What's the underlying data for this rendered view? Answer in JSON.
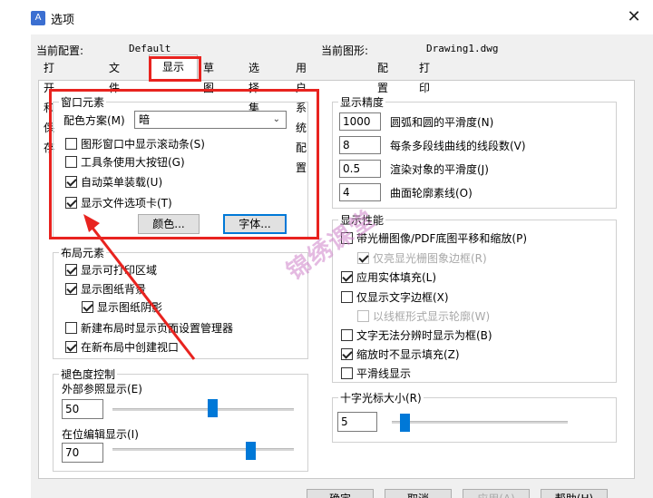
{
  "window": {
    "title": "选项",
    "close_glyph": "✕",
    "icon": "autocad-icon"
  },
  "config": {
    "profile_label": "当前配置:",
    "profile_value": "Default",
    "drawing_label": "当前图形:",
    "drawing_value": "Drawing1.dwg"
  },
  "tabs": [
    "打开和保存",
    "文件",
    "显示",
    "草图",
    "选择集",
    "用户系统配置",
    "配置",
    "打印"
  ],
  "active_tab": "显示",
  "window_elements": {
    "title": "窗口元素",
    "color_scheme_label": "配色方案(M)",
    "color_scheme_value": "暗",
    "checkboxes": [
      {
        "label": "图形窗口中显示滚动条(S)",
        "checked": false
      },
      {
        "label": "工具条使用大按钮(G)",
        "checked": false
      },
      {
        "label": "自动菜单装载(U)",
        "checked": true
      },
      {
        "label": "显示文件选项卡(T)",
        "checked": true
      }
    ],
    "colors_button": "颜色...",
    "fonts_button": "字体..."
  },
  "layout_elements": {
    "title": "布局元素",
    "checkboxes": [
      {
        "label": "显示可打印区域",
        "checked": true
      },
      {
        "label": "显示图纸背景",
        "checked": true
      },
      {
        "label": "显示图纸阴影",
        "checked": true
      },
      {
        "label": "新建布局时显示页面设置管理器",
        "checked": false
      },
      {
        "label": "在新布局中创建视口",
        "checked": true
      }
    ]
  },
  "fade_control": {
    "title": "褪色度控制",
    "xref_label": "外部参照显示(E)",
    "xref_value": "50",
    "xref_level": 50,
    "inplace_label": "在位编辑显示(I)",
    "inplace_value": "70",
    "inplace_level": 70
  },
  "display_resolution": {
    "title": "显示精度",
    "rows": [
      {
        "value": "1000",
        "label": "圆弧和圆的平滑度(N)"
      },
      {
        "value": "8",
        "label": "每条多段线曲线的线段数(V)"
      },
      {
        "value": "0.5",
        "label": "渲染对象的平滑度(J)"
      },
      {
        "value": "4",
        "label": "曲面轮廓素线(O)"
      }
    ]
  },
  "display_performance": {
    "title": "显示性能",
    "checkboxes": [
      {
        "label": "带光栅图像/PDF底图平移和缩放(P)",
        "checked": false,
        "disabled": false
      },
      {
        "label": "仅亮显光栅图象边框(R)",
        "checked": true,
        "disabled": true
      },
      {
        "label": "应用实体填充(L)",
        "checked": true,
        "disabled": false
      },
      {
        "label": "仅显示文字边框(X)",
        "checked": false,
        "disabled": false
      },
      {
        "label": "以线框形式显示轮廓(W)",
        "checked": false,
        "disabled": true
      },
      {
        "label": "文字无法分辨时显示为框(B)",
        "checked": false,
        "disabled": false
      },
      {
        "label": "缩放时不显示填充(Z)",
        "checked": true,
        "disabled": false
      },
      {
        "label": "平滑线显示",
        "checked": false,
        "disabled": false
      }
    ]
  },
  "crosshair": {
    "title": "十字光标大小(R)",
    "value": "5",
    "level": 5
  },
  "footer": {
    "ok": "确定",
    "cancel": "取消",
    "apply": "应用(A)",
    "help": "帮助(H)"
  },
  "watermark": "锦绣课堂",
  "annotation_color": "#e8231f",
  "accent_color": "#0078d7"
}
